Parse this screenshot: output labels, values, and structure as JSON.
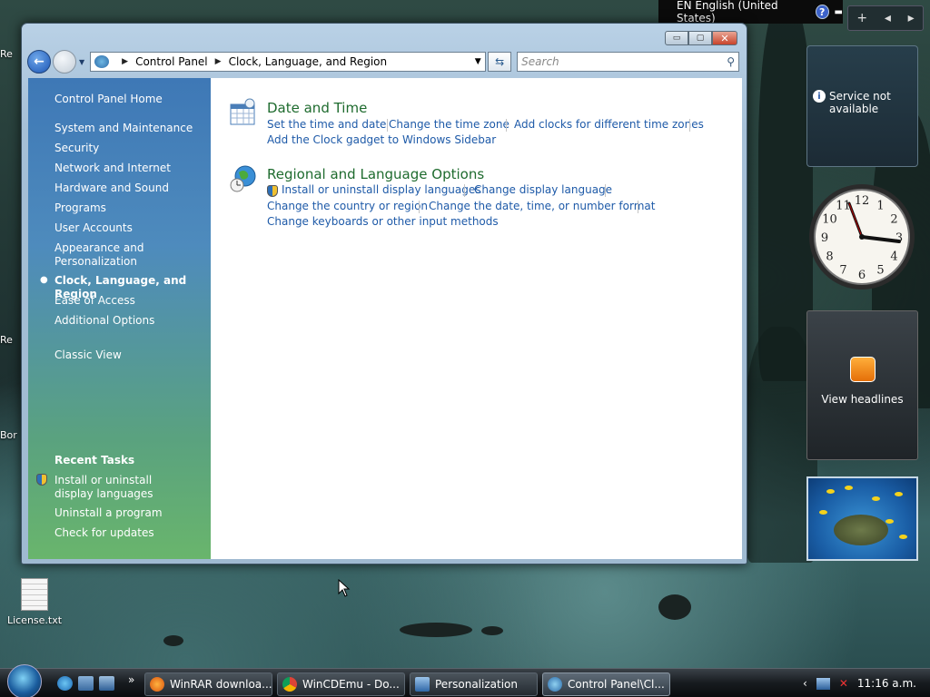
{
  "desktop": {
    "icons": [
      {
        "label": "License.txt"
      }
    ],
    "edge_fragments": [
      "Re",
      "Re",
      "Bor"
    ]
  },
  "language_bar": {
    "language": "EN English (United States)",
    "help_label": "?"
  },
  "sidebar": {
    "controls": {
      "add": "+",
      "prev": "◂",
      "next": "▸"
    },
    "weather": {
      "message": "Service not available"
    },
    "feed": {
      "label": "View headlines"
    },
    "clock": {
      "hour_numerals": [
        "12",
        "1",
        "2",
        "3",
        "4",
        "5",
        "6",
        "7",
        "8",
        "9",
        "10",
        "11"
      ]
    }
  },
  "window": {
    "caption": {
      "minimize": "▭",
      "maximize": "▢",
      "close": "✕"
    },
    "address": {
      "crumbs": [
        "Control Panel",
        "Clock, Language, and Region"
      ]
    },
    "search": {
      "placeholder": "Search"
    },
    "left_pane": {
      "home": "Control Panel Home",
      "categories": [
        "System and Maintenance",
        "Security",
        "Network and Internet",
        "Hardware and Sound",
        "Programs",
        "User Accounts",
        "Appearance and Personalization",
        "Clock, Language, and Region",
        "Ease of Access",
        "Additional Options"
      ],
      "current": "Clock, Language, and Region",
      "classic_view": "Classic View",
      "recent_heading": "Recent Tasks",
      "recent_tasks": [
        "Install or uninstall display languages",
        "Uninstall a program",
        "Check for updates"
      ]
    },
    "content": {
      "sections": [
        {
          "title": "Date and Time",
          "links": [
            "Set the time and date",
            "Change the time zone",
            "Add clocks for different time zones",
            "Add the Clock gadget to Windows Sidebar"
          ]
        },
        {
          "title": "Regional and Language Options",
          "links": [
            "Install or uninstall display languages",
            "Change display language",
            "Change the country or region",
            "Change the date, time, or number format",
            "Change keyboards or other input methods"
          ]
        }
      ]
    }
  },
  "taskbar": {
    "overflow": "»",
    "buttons": [
      {
        "label": "WinRAR downloa...",
        "active": false
      },
      {
        "label": "WinCDEmu - Do...",
        "active": false
      },
      {
        "label": "Personalization",
        "active": false
      },
      {
        "label": "Control Panel\\Cl...",
        "active": true
      }
    ],
    "tray": {
      "arrow": "‹",
      "time": "11:16 a.m."
    }
  },
  "colors": {
    "link": "#1e5aa8",
    "category_title": "#1e6b2e",
    "left_pane_top": "#3e78b6",
    "left_pane_bottom": "#69b56c"
  }
}
